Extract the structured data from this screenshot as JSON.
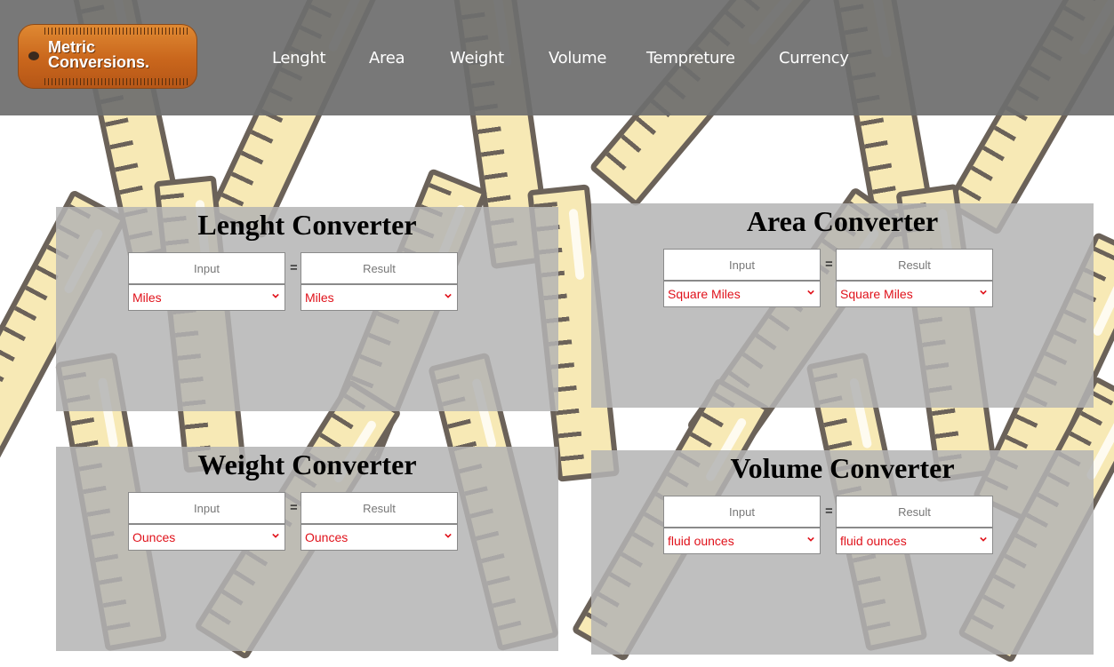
{
  "app": {
    "logo": "Metric Conversions."
  },
  "nav": {
    "items": [
      "Lenght",
      "Area",
      "Weight",
      "Volume",
      "Tempreture",
      "Currency"
    ]
  },
  "converters": {
    "length": {
      "title": "Lenght Converter",
      "input_placeholder": "Input",
      "result_placeholder": "Result",
      "equals": "=",
      "from_unit": "Miles",
      "to_unit": "Miles"
    },
    "area": {
      "title": "Area Converter",
      "input_placeholder": "Input",
      "result_placeholder": "Result",
      "equals": "=",
      "from_unit": "Square Miles",
      "to_unit": "Square Miles"
    },
    "weight": {
      "title": "Weight Converter",
      "input_placeholder": "Input",
      "result_placeholder": "Result",
      "equals": "=",
      "from_unit": "Ounces",
      "to_unit": "Ounces"
    },
    "volume": {
      "title": "Volume Converter",
      "input_placeholder": "Input",
      "result_placeholder": "Result",
      "equals": "=",
      "from_unit": "fluid ounces",
      "to_unit": "fluid ounces"
    }
  },
  "colors": {
    "navbar": "#6e6e6e",
    "panel": "#b4b4b4",
    "select_text": "#e0121b",
    "logo": "#d4742a"
  }
}
